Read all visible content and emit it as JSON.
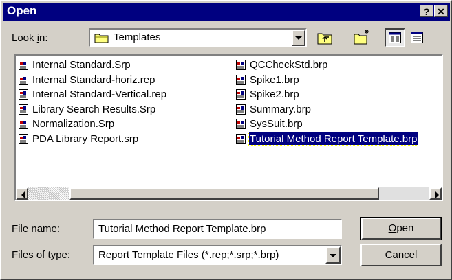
{
  "window": {
    "title": "Open",
    "help_label": "?",
    "close_label": "✕"
  },
  "look_in": {
    "label_pre": "Look ",
    "label_u": "i",
    "label_post": "n:",
    "value": "Templates"
  },
  "toolbar": {
    "icons": [
      "up-folder-icon",
      "new-folder-icon",
      "list-view-icon",
      "details-view-icon"
    ]
  },
  "files": {
    "column1": [
      "Internal Standard.Srp",
      "Internal Standard-horiz.rep",
      "Internal Standard-Vertical.rep",
      "Library Search Results.Srp",
      "Normalization.Srp",
      "PDA Library Report.srp"
    ],
    "column2": [
      "QCCheckStd.brp",
      "Spike1.brp",
      "Spike2.brp",
      "Summary.brp",
      "SysSuit.brp",
      "Tutorial Method Report Template.brp"
    ],
    "selected": "Tutorial Method Report Template.brp"
  },
  "file_name": {
    "label_pre": "File ",
    "label_u": "n",
    "label_post": "ame:",
    "value": "Tutorial Method Report Template.brp"
  },
  "files_of_type": {
    "label_pre": "Files of ",
    "label_u": "t",
    "label_post": "ype:",
    "value": "Report Template Files (*.rep;*.srp;*.brp)"
  },
  "buttons": {
    "open_u": "O",
    "open_rest": "pen",
    "cancel": "Cancel"
  },
  "colors": {
    "titlebar": "#000080",
    "face": "#d4d0c8",
    "selection": "#000080"
  }
}
